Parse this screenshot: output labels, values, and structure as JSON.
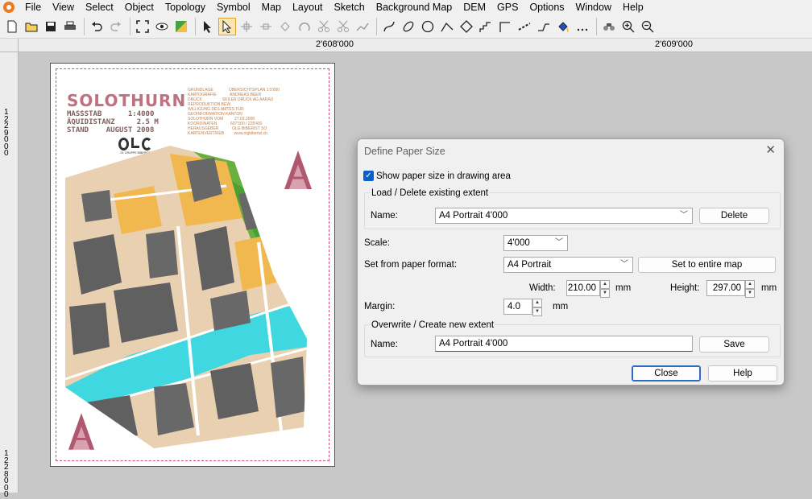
{
  "menubar": {
    "items": [
      "File",
      "View",
      "Select",
      "Object",
      "Topology",
      "Symbol",
      "Map",
      "Layout",
      "Sketch",
      "Background Map",
      "DEM",
      "GPS",
      "Options",
      "Window",
      "Help"
    ]
  },
  "toolbar": {
    "icons": [
      "new-file-icon",
      "open-folder-icon",
      "save-icon",
      "print-icon",
      "undo-icon",
      "redo-icon",
      "fit-view-icon",
      "preview-eye-icon",
      "color-mode-icon",
      "select-arrow-icon",
      "edit-point-icon",
      "freehand-curve-icon",
      "ellipse-icon",
      "circle-icon",
      "search-binoculars-icon",
      "zoom-in-icon",
      "zoom-out-icon"
    ]
  },
  "rulers": {
    "top": [
      "2'608'000",
      "2'609'000"
    ],
    "left": [
      "1229000",
      "1228000"
    ]
  },
  "map": {
    "title": "SOLOTHURN",
    "info": "MASSSTAB      1:4000\nÄQUIDISTANZ     2.5 M\nSTAND    AUGUST 2008",
    "credits": "GRUNDLAGE              ÜBERSICHTSPLAN 1:5'000\nKARTOGRAFIE            ANDREAS BEER\nDRUCK                  SKILER DRUCK AG AARAU\nREPRODUKTION BEW.\nWILLIGUNG DES AMTES FÜR\nGEOINFORMATION KANTON\nSOLOTHURN VOM          27.03.2008\nKOORDINATEN            607'500 / 228'400\nHERAUSGEBER            OLG BIBERIST SO\nKARTENVERTRIEB         www.olgbiberist.ch",
    "club": "OL GRUPPE BIBERIST"
  },
  "dialog": {
    "title": "Define Paper Size",
    "show_paper_label": "Show paper size in drawing area",
    "load_group_label": "Load / Delete existing extent",
    "name_label": "Name:",
    "load_name_value": "A4 Portrait 4'000",
    "delete_label": "Delete",
    "scale_label": "Scale:",
    "scale_value": "4'000",
    "paper_format_label": "Set from paper format:",
    "paper_format_value": "A4 Portrait",
    "set_entire_map_label": "Set to entire map",
    "width_label": "Width:",
    "width_value": "210.00",
    "height_label": "Height:",
    "height_value": "297.00",
    "unit_mm": "mm",
    "margin_label": "Margin:",
    "margin_value": "4.0",
    "overwrite_group_label": "Overwrite / Create new extent",
    "save_name_value": "A4 Portrait 4'000",
    "save_label": "Save",
    "close_label": "Close",
    "help_label": "Help",
    "close_x": "✕"
  }
}
